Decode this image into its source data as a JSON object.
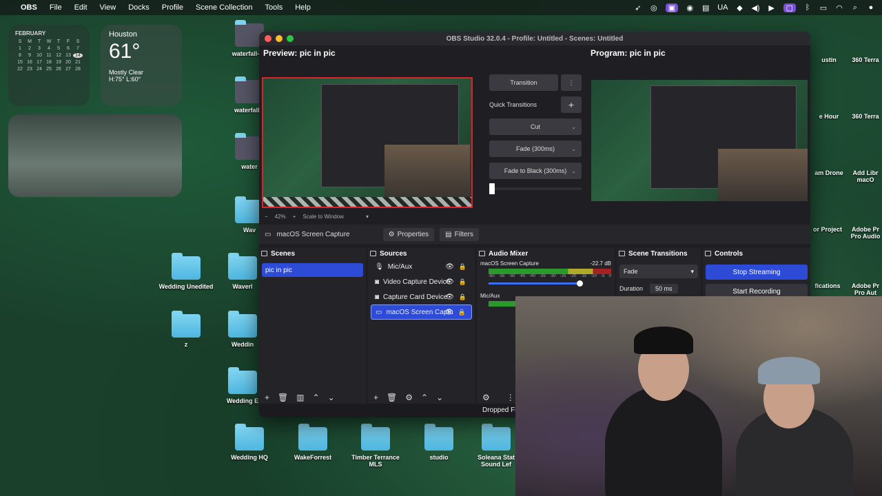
{
  "menubar": {
    "apple": "",
    "app": "OBS",
    "items": [
      "File",
      "Edit",
      "View",
      "Docks",
      "Profile",
      "Scene Collection",
      "Tools",
      "Help"
    ],
    "right_icons": [
      "rocket-icon",
      "globe-icon",
      "screen-record-icon",
      "chrome-icon",
      "ua-flag",
      "wifi-arrows-icon",
      "volume-icon",
      "play-icon",
      "window-icon",
      "bluetooth-icon",
      "battery-icon",
      "wifi-icon",
      "search-icon",
      "user-icon"
    ],
    "lang": "UA"
  },
  "calendar": {
    "month": "FEBRUARY",
    "weekdays": [
      "S",
      "M",
      "T",
      "W",
      "T",
      "F",
      "S"
    ],
    "days": [
      "1",
      "2",
      "3",
      "4",
      "5",
      "6",
      "7",
      "8",
      "9",
      "10",
      "11",
      "12",
      "13",
      "14",
      "15",
      "16",
      "17",
      "18",
      "19",
      "20",
      "21",
      "22",
      "23",
      "24",
      "25",
      "26",
      "27",
      "28"
    ],
    "today": "14"
  },
  "weather": {
    "city": "Houston",
    "temp": "61°",
    "condition": "Mostly Clear",
    "hilo": "H:75° L:60°"
  },
  "desktop_left_icons": [
    {
      "label": "waterfall-Ec"
    },
    {
      "label": "waterfall..."
    },
    {
      "label": "water"
    },
    {
      "label": "Wav"
    },
    {
      "label": "Wedding Unedited"
    },
    {
      "label": "Waverl"
    },
    {
      "label": "z"
    },
    {
      "label": "Weddin"
    },
    {
      "label": "Wedding E"
    }
  ],
  "desktop_bottom_icons": [
    {
      "label": "Wedding HQ"
    },
    {
      "label": "WakeForrest"
    },
    {
      "label": "Timber Terrance MLS"
    },
    {
      "label": "studio"
    },
    {
      "label": "Soleana Stat Sound Lef"
    }
  ],
  "desktop_right_labels": [
    "ustin",
    "360 Terra",
    "e Hour",
    "360 Terra",
    "am Drone",
    "Add Libr macO",
    "or Project",
    "Adobe Pr Pro Audio",
    "fications",
    "Adobe Pr Pro Aut"
  ],
  "obs": {
    "title": "OBS Studio 32.0.4 - Profile: Untitled - Scenes: Untitled",
    "preview_title": "Preview: pic in pic",
    "program_title": "Program: pic in pic",
    "zoom": "42%",
    "scale_label": "Scale to Window",
    "transition_label": "Transition",
    "quick_transitions": "Quick Transitions",
    "quick": [
      "Cut",
      "Fade (300ms)",
      "Fade to Black (300ms)"
    ],
    "source_bar": {
      "source_name": "macOS Screen Capture",
      "properties": "Properties",
      "filters": "Filters"
    },
    "scenes": {
      "title": "Scenes",
      "items": [
        "pic in pic"
      ]
    },
    "sources": {
      "title": "Sources",
      "items": [
        {
          "name": "Mic/Aux",
          "icon": "mic-icon"
        },
        {
          "name": "Video Capture Device",
          "icon": "camera-icon"
        },
        {
          "name": "Capture Card Device",
          "icon": "camera-icon"
        },
        {
          "name": "macOS Screen Captu",
          "icon": "monitor-icon"
        }
      ]
    },
    "mixer": {
      "title": "Audio Mixer",
      "channels": [
        {
          "name": "macOS Screen Capture",
          "db": "-22.7 dB"
        },
        {
          "name": "Mic/Aux",
          "db": ""
        }
      ],
      "scale": [
        "-60",
        "-55",
        "-50",
        "-45",
        "-40",
        "-35",
        "-30",
        "-25",
        "-20",
        "-15",
        "-10",
        "-5",
        "0"
      ]
    },
    "scene_transitions": {
      "title": "Scene Transitions",
      "selected": "Fade",
      "duration_label": "Duration",
      "duration_value": "50 ms"
    },
    "controls": {
      "title": "Controls",
      "stop_streaming": "Stop Streaming",
      "start_recording": "Start Recording"
    },
    "status": "Dropped Fr"
  },
  "colors": {
    "accent": "#2d4bd6",
    "preview_border": "#e0202a"
  }
}
